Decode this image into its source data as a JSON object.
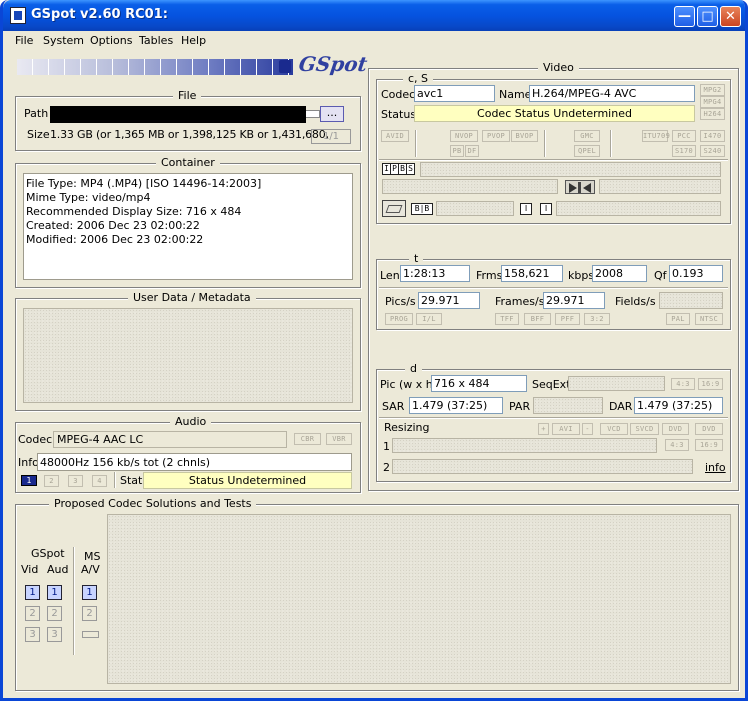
{
  "window": {
    "title": "GSpot v2.60 RC01:"
  },
  "menu": [
    "File",
    "System",
    "Options",
    "Tables",
    "Help"
  ],
  "logo": "GSpot",
  "file": {
    "group": "File",
    "path_label": "Path",
    "browse_label": "...",
    "size_label": "Size",
    "size_value": "1.33 GB (or 1,365 MB or 1,398,125 KB or 1,431,680,",
    "page_counter": "1/1"
  },
  "container": {
    "group": "Container",
    "lines": [
      "File Type: MP4 (.MP4) [ISO 14496-14:2003]",
      "Mime Type: video/mp4",
      "Recommended Display Size: 716 x 484",
      "Created:    2006 Dec 23   02:00:22",
      "Modified:   2006 Dec 23   02:00:22"
    ]
  },
  "userdata": {
    "group": "User Data / Metadata"
  },
  "audio": {
    "group": "Audio",
    "codec_label": "Codec",
    "codec_value": "MPEG-4 AAC LC",
    "cbr": "CBR",
    "vbr": "VBR",
    "info_label": "Info",
    "info_value": "48000Hz  156 kb/s tot (2 chnls)",
    "tracks": [
      "1",
      "2",
      "3",
      "4"
    ],
    "stat_label": "Stat",
    "stat_value": "Status Undetermined"
  },
  "video": {
    "group": "Video",
    "cs": {
      "group": "c, S",
      "codec_label": "Codec",
      "codec_value": "avc1",
      "name_label": "Name",
      "name_value": "H.264/MPEG-4 AVC",
      "status_label": "Status",
      "status_value": "Codec Status Undetermined",
      "side_tags": [
        "MPG2",
        "MPG4",
        "H264"
      ],
      "tags_row1": [
        "AVID",
        "NVOP",
        "PVOP",
        "BVOP",
        "GMC",
        "ITU709",
        "PCC",
        "I470"
      ],
      "tags_row2": [
        "PB",
        "DF",
        "QPEL",
        "S170",
        "S240"
      ],
      "frame_tags": [
        "I",
        "P",
        "B",
        "S"
      ],
      "bb_tag": "B|B",
      "i_tag": "I",
      "i_tag2": "I"
    },
    "t": {
      "group": "t",
      "len_label": "Len",
      "len_value": "1:28:13",
      "frms_label": "Frms",
      "frms_value": "158,621",
      "kbps_label": "kbps",
      "kbps_value": "2008",
      "qf_label": "Qf",
      "qf_value": "0.193",
      "pics_label": "Pics/s",
      "pics_value": "29.971",
      "frames_label": "Frames/s",
      "frames_value": "29.971",
      "fields_label": "Fields/s",
      "tags": [
        "PROG",
        "I/L",
        "TFF",
        "BFF",
        "PFF",
        "3:2",
        "PAL",
        "NTSC"
      ]
    },
    "d": {
      "group": "d",
      "pic_label": "Pic (w x h)",
      "pic_value": "716 x 484",
      "seqext_label": "SeqExt",
      "r43": "4:3",
      "r169": "16:9",
      "sar_label": "SAR",
      "sar_value": "1.479 (37:25)",
      "par_label": "PAR",
      "dar_label": "DAR",
      "dar_value": "1.479 (37:25)",
      "resizing_label": "Resizing",
      "plus": "+",
      "avi": "AVI",
      "minus": "-",
      "vcd": "VCD",
      "svcd": "SVCD",
      "dvd1": "DVD",
      "dvd2": "DVD",
      "row1": "1",
      "row2": "2",
      "r43b": "4:3",
      "r169b": "16:9",
      "info": "info"
    }
  },
  "proposed": {
    "group": "Proposed Codec Solutions and Tests",
    "gspot": "GSpot",
    "vid": "Vid",
    "aud": "Aud",
    "ms": "MS",
    "av": "A/V",
    "n1": "1",
    "n2": "2",
    "n3": "3"
  }
}
